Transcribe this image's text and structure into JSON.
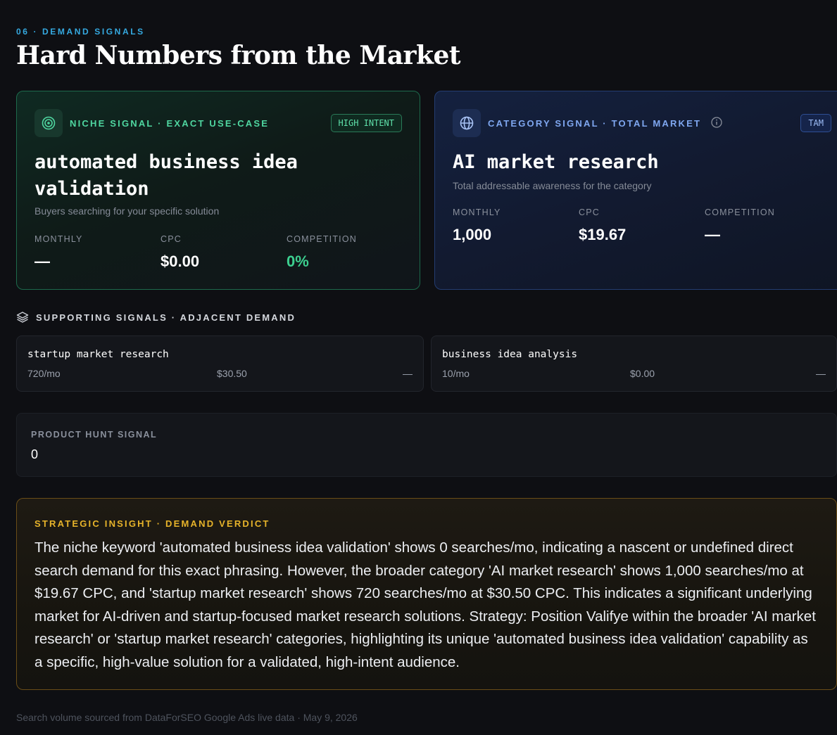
{
  "header": {
    "eyebrow": "06 · DEMAND SIGNALS",
    "title": "Hard Numbers from the Market"
  },
  "niche": {
    "label": "NICHE SIGNAL · EXACT USE-CASE",
    "badge": "HIGH INTENT",
    "icon": "target-icon",
    "keyword": "automated business idea validation",
    "subtext": "Buyers searching for your specific solution",
    "metrics": [
      {
        "label": "MONTHLY",
        "value": "—"
      },
      {
        "label": "CPC",
        "value": "$0.00"
      },
      {
        "label": "COMPETITION",
        "value": "0%"
      }
    ],
    "accent": "#3ccf8f"
  },
  "category": {
    "label": "CATEGORY SIGNAL · TOTAL MARKET",
    "badge": "TAM",
    "icon": "globe-icon",
    "keyword": "AI market research",
    "subtext": "Total addressable awareness for the category",
    "metrics": [
      {
        "label": "MONTHLY",
        "value": "1,000"
      },
      {
        "label": "CPC",
        "value": "$19.67"
      },
      {
        "label": "COMPETITION",
        "value": "—"
      }
    ],
    "accent": "#7fa7f0"
  },
  "supporting": {
    "title": "SUPPORTING SIGNALS · ADJACENT DEMAND",
    "items": [
      {
        "keyword": "startup market research",
        "volume": "720/mo",
        "cpc": "$30.50",
        "competition": "—"
      },
      {
        "keyword": "business idea analysis",
        "volume": "10/mo",
        "cpc": "$0.00",
        "competition": "—"
      }
    ]
  },
  "product_hunt": {
    "label": "PRODUCT HUNT SIGNAL",
    "value": "0"
  },
  "insight": {
    "label": "STRATEGIC INSIGHT · DEMAND VERDICT",
    "body": "The niche keyword 'automated business idea validation' shows 0 searches/mo, indicating a nascent or undefined direct search demand for this exact phrasing. However, the broader category 'AI market research' shows 1,000 searches/mo at $19.67 CPC, and 'startup market research' shows 720 searches/mo at $30.50 CPC. This indicates a significant underlying market for AI-driven and startup-focused market research solutions. Strategy: Position Valifye within the broader 'AI market research' or 'startup market research' categories, highlighting its unique 'automated business idea validation' capability as a specific, high-value solution for a validated, high-intent audience.",
    "accent": "#e6b32a"
  },
  "footer": {
    "text": "Search volume sourced from DataForSEO Google Ads live data · May 9, 2026"
  }
}
